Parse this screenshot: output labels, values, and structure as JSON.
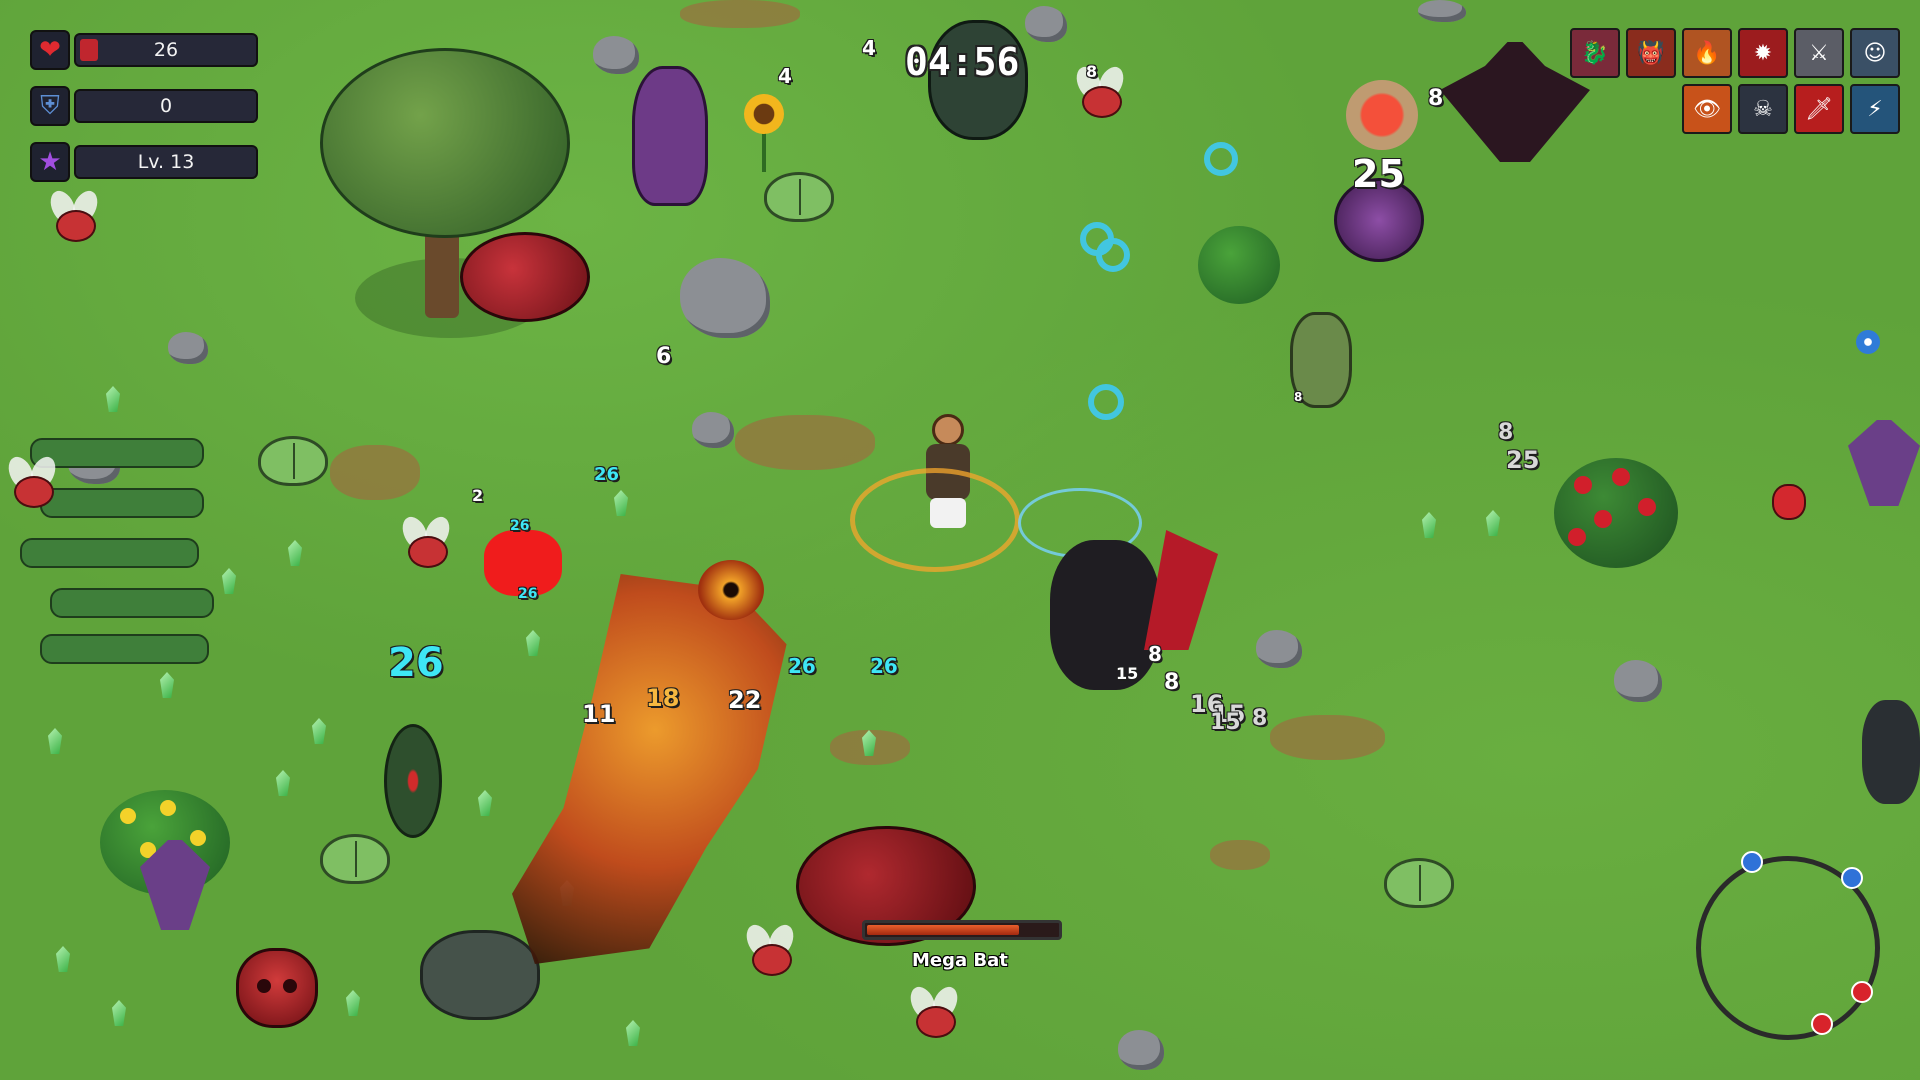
{
  "hud": {
    "health": {
      "value": "26",
      "fraction": 0.1,
      "icon": "heart-icon",
      "color": "#c0262e"
    },
    "armor": {
      "value": "0",
      "icon": "shield-icon"
    },
    "level": {
      "value": "Lv. 13",
      "icon": "star-icon"
    }
  },
  "timer": "04:56",
  "skills": [
    {
      "name": "fire-dragon-skill-icon",
      "color": "#7a2a3a"
    },
    {
      "name": "demon-skill-icon",
      "color": "#8a2c1d"
    },
    {
      "name": "ring-of-fire-skill-icon",
      "color": "#b05422"
    },
    {
      "name": "red-burst-skill-icon",
      "color": "#9c1c1e"
    },
    {
      "name": "sword-skill-icon",
      "color": "#5b5d66"
    },
    {
      "name": "hero-portrait-icon",
      "color": "#3a5066"
    },
    {
      "name": "eye-skill-icon",
      "color": "#c8521a"
    },
    {
      "name": "shadow-skill-icon",
      "color": "#2c3340"
    },
    {
      "name": "blood-blade-skill-icon",
      "color": "#b71e1e"
    },
    {
      "name": "lightning-skill-icon",
      "color": "#24547a"
    }
  ],
  "damage_numbers": [
    {
      "text": "4",
      "style": "white",
      "size": 20
    },
    {
      "text": "4",
      "style": "white",
      "size": 20
    },
    {
      "text": "8",
      "style": "white",
      "size": 16
    },
    {
      "text": "8",
      "style": "white",
      "size": 22
    },
    {
      "text": "25",
      "style": "white",
      "size": 38
    },
    {
      "text": "6",
      "style": "white",
      "size": 22
    },
    {
      "text": "26",
      "style": "cyan",
      "size": 18
    },
    {
      "text": "2",
      "style": "white",
      "size": 16
    },
    {
      "text": "26",
      "style": "cyan",
      "size": 14
    },
    {
      "text": "26",
      "style": "cyan",
      "size": 14
    },
    {
      "text": "26",
      "style": "cyan",
      "size": 40
    },
    {
      "text": "26",
      "style": "cyan",
      "size": 20
    },
    {
      "text": "26",
      "style": "cyan",
      "size": 20
    },
    {
      "text": "11",
      "style": "white",
      "size": 24
    },
    {
      "text": "18",
      "style": "gold",
      "size": 24
    },
    {
      "text": "22",
      "style": "white",
      "size": 24
    },
    {
      "text": "8",
      "style": "white",
      "size": 20
    },
    {
      "text": "15",
      "style": "white",
      "size": 16
    },
    {
      "text": "8",
      "style": "white",
      "size": 22
    },
    {
      "text": "16",
      "style": "grey",
      "size": 24
    },
    {
      "text": "15",
      "style": "grey",
      "size": 24
    },
    {
      "text": "15",
      "style": "grey",
      "size": 22
    },
    {
      "text": "8",
      "style": "grey",
      "size": 22
    },
    {
      "text": "8",
      "style": "grey",
      "size": 22
    },
    {
      "text": "25",
      "style": "grey",
      "size": 24
    },
    {
      "text": "8",
      "style": "white",
      "size": 12
    }
  ],
  "boss": {
    "name": "Mega Bat",
    "health_fraction": 0.8
  }
}
